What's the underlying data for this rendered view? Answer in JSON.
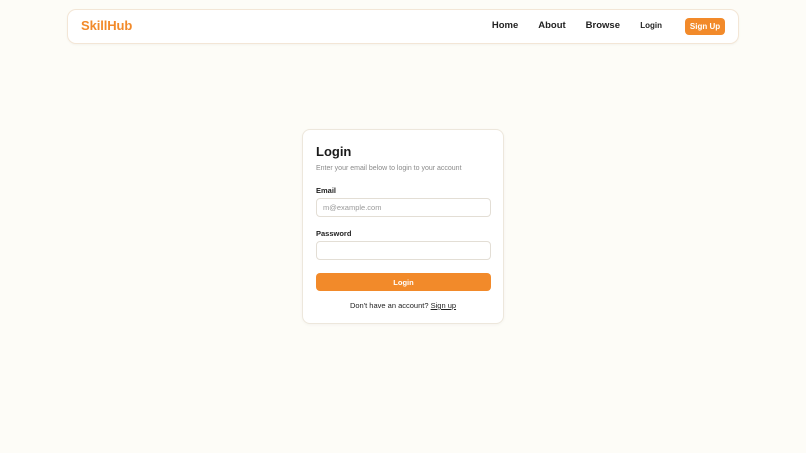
{
  "navbar": {
    "brand": "SkillHub",
    "links": [
      "Home",
      "About",
      "Browse"
    ],
    "login_label": "Login",
    "signup_label": "Sign Up"
  },
  "login_card": {
    "title": "Login",
    "description": "Enter your email below to login to your account",
    "email_label": "Email",
    "email_placeholder": "m@example.com",
    "email_value": "",
    "password_label": "Password",
    "password_value": "",
    "submit_label": "Login",
    "signup_prompt": "Don't have an account?",
    "signup_link": "Sign up"
  },
  "colors": {
    "accent": "#f28a2a",
    "background": "#fdfcf7"
  }
}
